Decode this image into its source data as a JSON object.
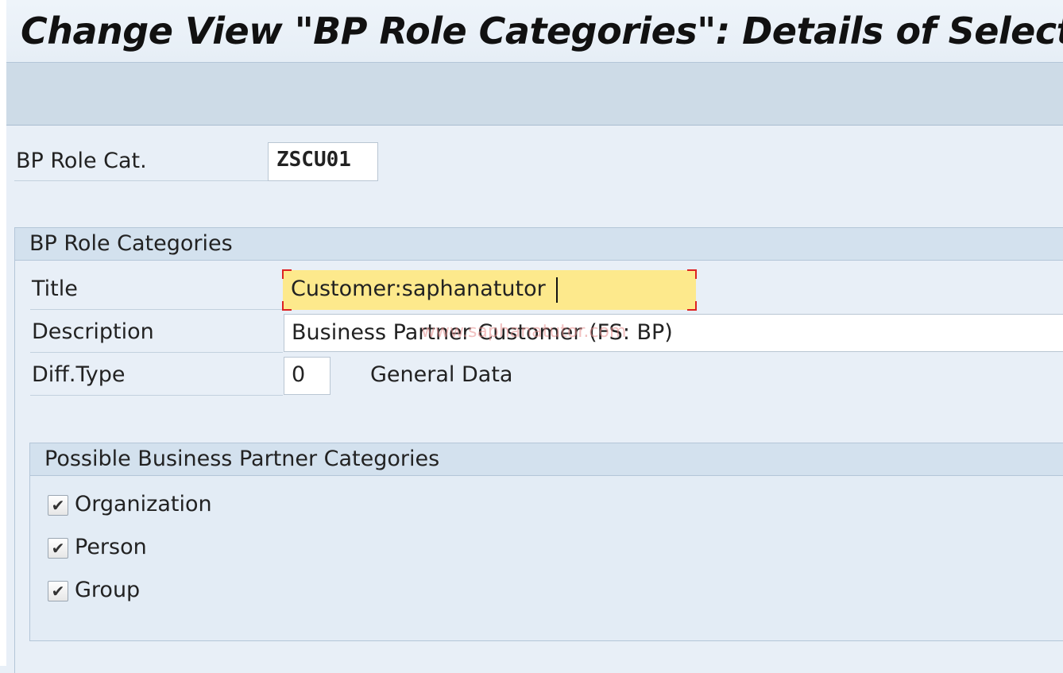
{
  "window": {
    "title": "Change View \"BP Role Categories\": Details of Selected Set"
  },
  "header_field": {
    "label": "BP Role Cat.",
    "value": "ZSCU01"
  },
  "role_group": {
    "heading": "BP Role Categories",
    "title_label": "Title",
    "title_value": "Customer:saphanatutor",
    "description_label": "Description",
    "description_value": "Business Partner Customer (FS: BP)",
    "difftype_label": "Diff.Type",
    "difftype_value": "0",
    "difftype_text": "General Data",
    "watermark": "www.saphanatutor.com"
  },
  "categories_group": {
    "heading": "Possible Business Partner Categories",
    "items": [
      {
        "label": "Organization",
        "checked": true
      },
      {
        "label": "Person",
        "checked": true
      },
      {
        "label": "Group",
        "checked": true
      }
    ]
  },
  "colors": {
    "title_input_bg": "#fde98c",
    "focus_corners": "#dd2222"
  }
}
